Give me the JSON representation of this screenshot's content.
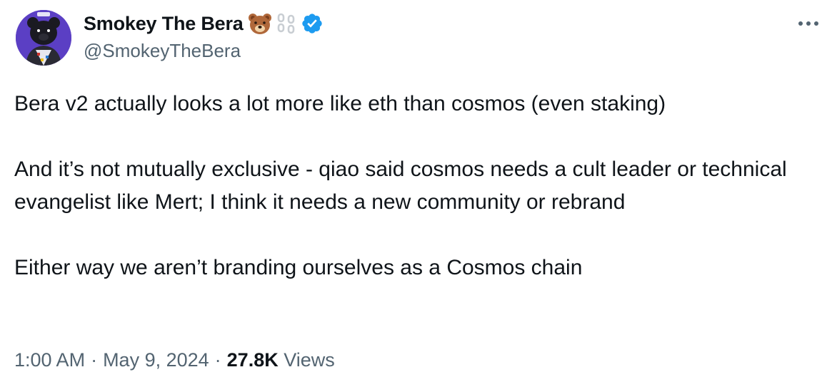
{
  "author": {
    "display_name": "Smokey The Bera",
    "handle": "@SmokeyTheBera",
    "verified": true,
    "name_emoji": "bear-face-icon",
    "name_extra_icon": "chain-icon",
    "avatar_icon": "bear-avatar",
    "verified_color": "#1d9bf0"
  },
  "tweet": {
    "paragraphs": [
      "Bera v2 actually looks a lot more like eth than cosmos (even staking)",
      "And it’s not mutually exclusive - qiao said cosmos needs a cult leader or technical evangelist like Mert; I think it needs a new community or rebrand",
      "Either way we aren’t branding ourselves as a Cosmos chain"
    ]
  },
  "meta": {
    "time": "1:00 AM",
    "date": "May 9, 2024",
    "separator": "·",
    "views_count": "27.8K",
    "views_label": "Views"
  },
  "colors": {
    "text": "#0f1419",
    "secondary": "#536471",
    "avatar_bg": "#5b3fc4"
  }
}
